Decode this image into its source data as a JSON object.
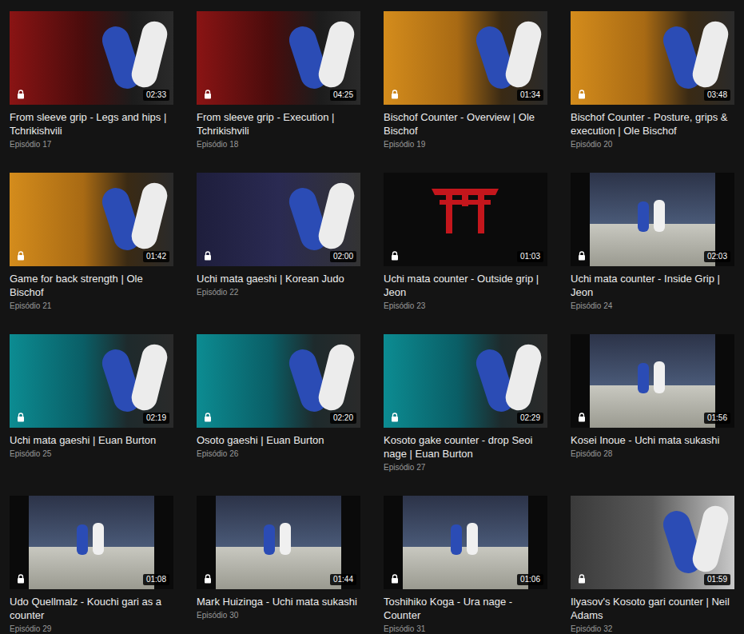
{
  "videos": [
    {
      "title": "From sleeve grip - Legs and hips | Tchrikishvili",
      "episode": "Episódio 17",
      "duration": "02:33",
      "locked": true,
      "kind": "georgian"
    },
    {
      "title": "From sleeve grip - Execution | Tchrikishvili",
      "episode": "Episódio 18",
      "duration": "04:25",
      "locked": true,
      "kind": "georgian"
    },
    {
      "title": "Bischof Counter - Overview | Ole Bischof",
      "episode": "Episódio 19",
      "duration": "01:34",
      "locked": true,
      "kind": "bischof"
    },
    {
      "title": "Bischof Counter - Posture, grips & execution | Ole Bischof",
      "episode": "Episódio 20",
      "duration": "03:48",
      "locked": true,
      "kind": "bischof"
    },
    {
      "title": "Game for back strength | Ole Bischof",
      "episode": "Episódio 21",
      "duration": "01:42",
      "locked": true,
      "kind": "bischof"
    },
    {
      "title": "Uchi mata gaeshi | Korean Judo",
      "episode": "Episódio 22",
      "duration": "02:00",
      "locked": true,
      "kind": "korean"
    },
    {
      "title": "Uchi mata counter - Outside grip | Jeon",
      "episode": "Episódio 23",
      "duration": "01:03",
      "locked": true,
      "kind": "logo"
    },
    {
      "title": "Uchi mata counter - Inside Grip | Jeon",
      "episode": "Episódio 24",
      "duration": "02:03",
      "locked": true,
      "kind": "footage"
    },
    {
      "title": "Uchi mata gaeshi | Euan Burton",
      "episode": "Episódio 25",
      "duration": "02:19",
      "locked": true,
      "kind": "burton"
    },
    {
      "title": "Osoto gaeshi | Euan Burton",
      "episode": "Episódio 26",
      "duration": "02:20",
      "locked": true,
      "kind": "burton"
    },
    {
      "title": "Kosoto gake counter - drop Seoi nage | Euan Burton",
      "episode": "Episódio 27",
      "duration": "02:29",
      "locked": true,
      "kind": "burton"
    },
    {
      "title": "Kosei Inoue - Uchi mata sukashi",
      "episode": "Episódio 28",
      "duration": "01:56",
      "locked": true,
      "kind": "footage"
    },
    {
      "title": "Udo Quellmalz - Kouchi gari as a counter",
      "episode": "Episódio 29",
      "duration": "01:08",
      "locked": true,
      "kind": "footage"
    },
    {
      "title": "Mark Huizinga - Uchi mata sukashi",
      "episode": "Episódio 30",
      "duration": "01:44",
      "locked": true,
      "kind": "footage"
    },
    {
      "title": "Toshihiko Koga - Ura nage - Counter",
      "episode": "Episódio 31",
      "duration": "01:06",
      "locked": true,
      "kind": "footage"
    },
    {
      "title": "Ilyasov's Kosoto gari counter | Neil Adams",
      "episode": "Episódio 32",
      "duration": "01:59",
      "locked": true,
      "kind": "analysis"
    }
  ]
}
